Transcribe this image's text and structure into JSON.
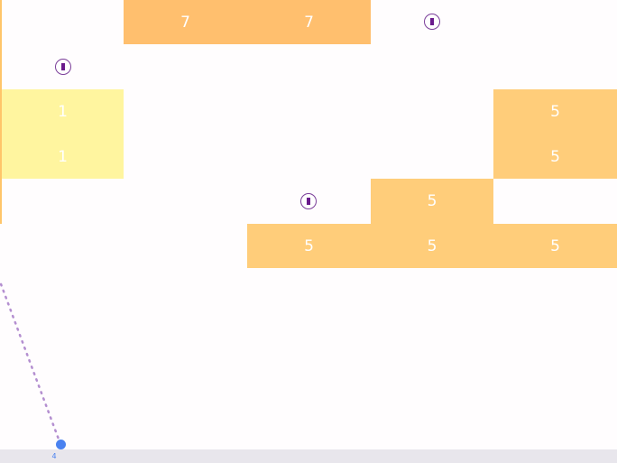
{
  "blocks": [
    {
      "id": "b-r0-c1",
      "value": "7",
      "color": "#ffbf6e"
    },
    {
      "id": "b-r0-c2",
      "value": "7",
      "color": "#ffbf6e"
    },
    {
      "id": "b-r2-c0",
      "value": "1",
      "color": "#fff59f"
    },
    {
      "id": "b-r3-c0",
      "value": "1",
      "color": "#fff59f"
    },
    {
      "id": "b-r2-c4",
      "value": "5",
      "color": "#ffcd7a"
    },
    {
      "id": "b-r3-c4",
      "value": "5",
      "color": "#ffcd7a"
    },
    {
      "id": "b-r4-c3",
      "value": "5",
      "color": "#ffcd7a"
    },
    {
      "id": "b-r5-c2",
      "value": "5",
      "color": "#ffcd7a"
    },
    {
      "id": "b-r5-c3",
      "value": "5",
      "color": "#ffcd7a"
    },
    {
      "id": "b-r5-c4",
      "value": "5",
      "color": "#ffcd7a"
    }
  ],
  "ball_pickups": [
    "extra-ball-icon",
    "extra-ball-icon",
    "extra-ball-icon"
  ],
  "launcher": {
    "ball_count": "4",
    "color": "#4a82f0"
  },
  "aim_line_color": "#b48fd0"
}
